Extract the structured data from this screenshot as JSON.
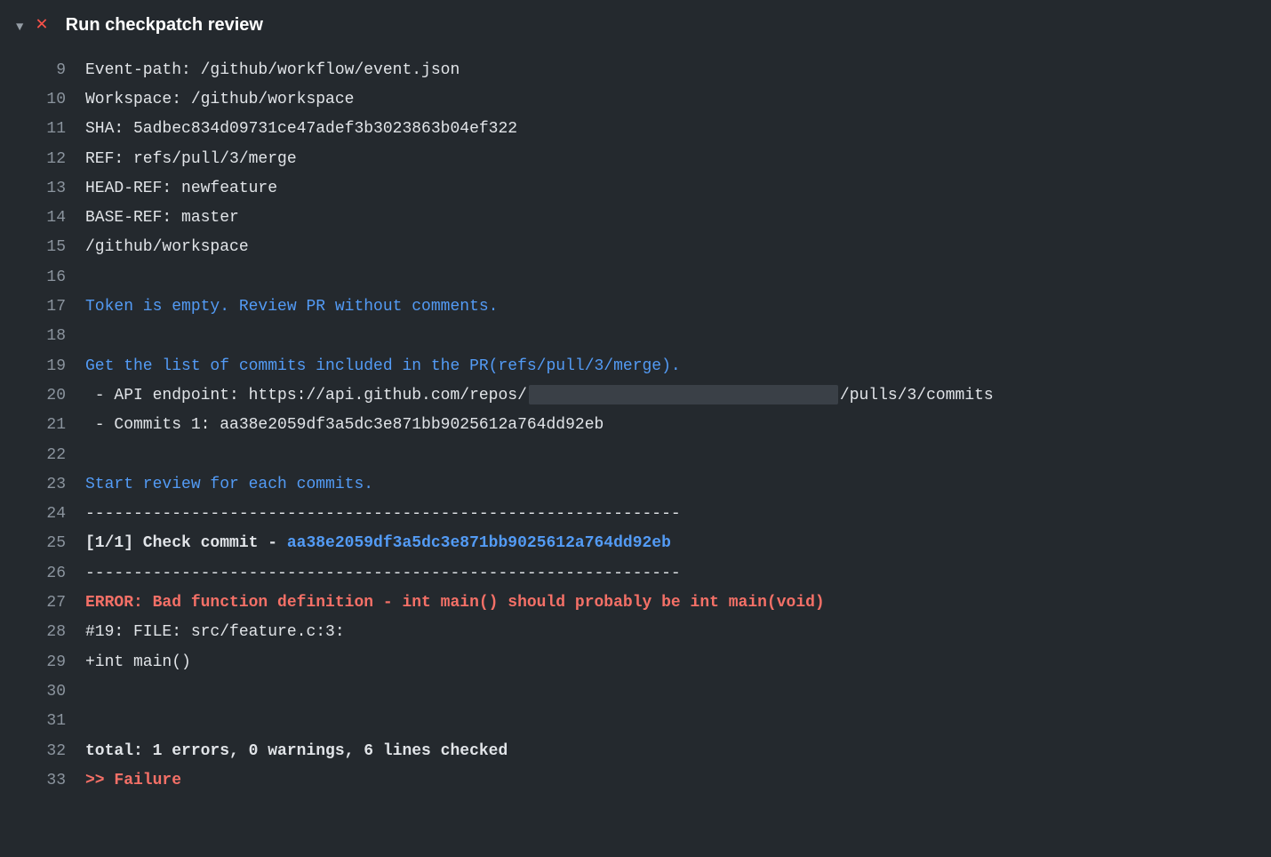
{
  "header": {
    "title": "Run checkpatch review"
  },
  "lines": [
    {
      "num": "9",
      "segments": [
        {
          "text": "Event-path: /github/workflow/event.json",
          "cls": "text-white"
        }
      ]
    },
    {
      "num": "10",
      "segments": [
        {
          "text": "Workspace: /github/workspace",
          "cls": "text-white"
        }
      ]
    },
    {
      "num": "11",
      "segments": [
        {
          "text": "SHA: 5adbec834d09731ce47adef3b3023863b04ef322",
          "cls": "text-white"
        }
      ]
    },
    {
      "num": "12",
      "segments": [
        {
          "text": "REF: refs/pull/3/merge",
          "cls": "text-white"
        }
      ]
    },
    {
      "num": "13",
      "segments": [
        {
          "text": "HEAD-REF: newfeature",
          "cls": "text-white"
        }
      ]
    },
    {
      "num": "14",
      "segments": [
        {
          "text": "BASE-REF: master",
          "cls": "text-white"
        }
      ]
    },
    {
      "num": "15",
      "segments": [
        {
          "text": "/github/workspace",
          "cls": "text-white"
        }
      ]
    },
    {
      "num": "16",
      "segments": [
        {
          "text": "",
          "cls": "text-white"
        }
      ]
    },
    {
      "num": "17",
      "segments": [
        {
          "text": "Token is empty. Review PR without comments.",
          "cls": "text-blue"
        }
      ]
    },
    {
      "num": "18",
      "segments": [
        {
          "text": "",
          "cls": "text-white"
        }
      ]
    },
    {
      "num": "19",
      "segments": [
        {
          "text": "Get the list of commits included in the PR(refs/pull/3/merge).",
          "cls": "text-blue"
        }
      ]
    },
    {
      "num": "20",
      "segments": [
        {
          "text": " - API endpoint: https://api.github.com/repos/",
          "cls": "text-white"
        },
        {
          "redacted": true
        },
        {
          "text": "/pulls/3/commits",
          "cls": "text-white"
        }
      ]
    },
    {
      "num": "21",
      "segments": [
        {
          "text": " - Commits 1: aa38e2059df3a5dc3e871bb9025612a764dd92eb",
          "cls": "text-white"
        }
      ]
    },
    {
      "num": "22",
      "segments": [
        {
          "text": "",
          "cls": "text-white"
        }
      ]
    },
    {
      "num": "23",
      "segments": [
        {
          "text": "Start review for each commits.",
          "cls": "text-blue"
        }
      ]
    },
    {
      "num": "24",
      "segments": [
        {
          "text": "--------------------------------------------------------------",
          "cls": "text-white"
        }
      ]
    },
    {
      "num": "25",
      "segments": [
        {
          "text": "[1/1] Check commit - ",
          "cls": "text-white text-bold"
        },
        {
          "text": "aa38e2059df3a5dc3e871bb9025612a764dd92eb",
          "cls": "text-blue text-bold"
        }
      ]
    },
    {
      "num": "26",
      "segments": [
        {
          "text": "--------------------------------------------------------------",
          "cls": "text-white"
        }
      ]
    },
    {
      "num": "27",
      "segments": [
        {
          "text": "ERROR: Bad function definition - int main() should probably be int main(void)",
          "cls": "text-red text-bold"
        }
      ]
    },
    {
      "num": "28",
      "segments": [
        {
          "text": "#19: FILE: src/feature.c:3:",
          "cls": "text-white"
        }
      ]
    },
    {
      "num": "29",
      "segments": [
        {
          "text": "+int main()",
          "cls": "text-white"
        }
      ]
    },
    {
      "num": "30",
      "segments": [
        {
          "text": "",
          "cls": "text-white"
        }
      ]
    },
    {
      "num": "31",
      "segments": [
        {
          "text": "",
          "cls": "text-white"
        }
      ]
    },
    {
      "num": "32",
      "segments": [
        {
          "text": "total: 1 errors, 0 warnings, 6 lines checked",
          "cls": "text-white text-bold"
        }
      ]
    },
    {
      "num": "33",
      "segments": [
        {
          "text": ">> ",
          "cls": "text-red text-bold"
        },
        {
          "text": "Failure",
          "cls": "text-red text-bold"
        }
      ]
    }
  ]
}
